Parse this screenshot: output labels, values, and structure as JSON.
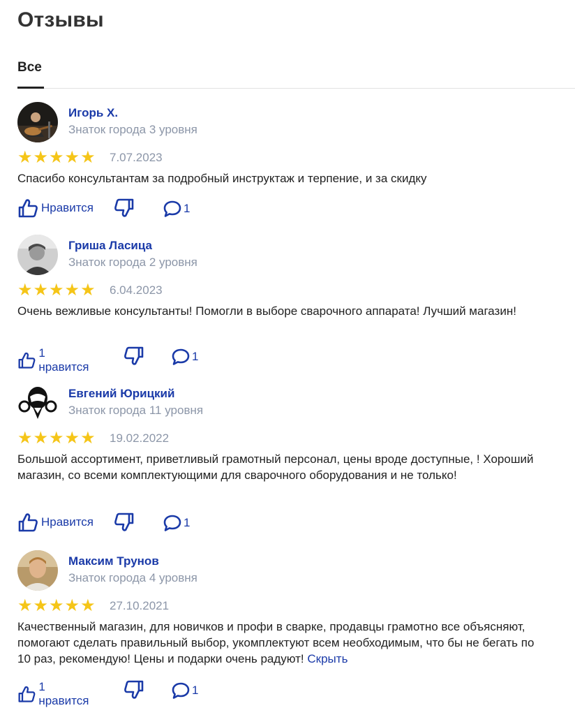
{
  "page": {
    "title": "Отзывы"
  },
  "tabs": [
    {
      "label": "Все",
      "active": true
    }
  ],
  "colors": {
    "link": "#1a3aa8",
    "star": "#f5c518",
    "muted": "#8c96a8"
  },
  "reviews": [
    {
      "author": "Игорь Х.",
      "level": "Знаток города 3 уровня",
      "stars": 5,
      "date": "7.07.2023",
      "text": "Спасибо консультантам за подробный инструктаж и терпение, и за скидку",
      "like_label": "Нравится",
      "comments": "1"
    },
    {
      "author": "Гриша Ласица",
      "level": "Знаток города 2 уровня",
      "stars": 5,
      "date": "6.04.2023",
      "text": "Очень вежливые консультанты! Помогли в выборе сварочного аппарата! Лучший магазин!",
      "like_label": "1 нравится",
      "comments": "1"
    },
    {
      "author": "Евгений Юрицкий",
      "level": "Знаток города 11 уровня",
      "stars": 5,
      "date": "19.02.2022",
      "text": "Большой ассортимент, приветливый грамотный персонал, цены вроде доступные, ! Хороший магазин, со всеми комплектующими для сварочного оборудования и не только!",
      "like_label": "Нравится",
      "comments": "1"
    },
    {
      "author": "Максим Трунов",
      "level": "Знаток города 4 уровня",
      "stars": 5,
      "date": "27.10.2021",
      "text": "Качественный магазин, для новичков и профи в сварке, продавцы грамотно все объясняют, помогают сделать правильный выбор, укомплектуют всем необходимым, что бы не бегать по 10 раз, рекомендую! Цены и подарки очень радуют!",
      "hide_label": "Скрыть",
      "like_label": "1 нравится",
      "comments": "1"
    }
  ]
}
